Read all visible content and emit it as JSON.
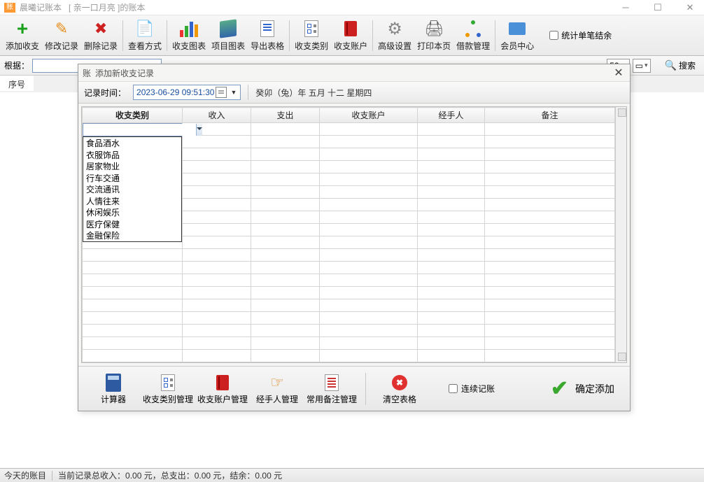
{
  "titlebar": {
    "app_name": "晨曦记账本",
    "book_name": "[ 亲一口月亮 ]的账本"
  },
  "toolbar": {
    "add": "添加收支",
    "edit": "修改记录",
    "delete": "删除记录",
    "view": "查看方式",
    "bar_chart": "收支图表",
    "item_chart": "项目图表",
    "export": "导出表格",
    "category": "收支类别",
    "account": "收支账户",
    "advanced": "高级设置",
    "print": "打印本页",
    "loan": "借款管理",
    "member": "会员中心",
    "stat_check": "统计单笔结余"
  },
  "search": {
    "label": "根据：",
    "counter": "59",
    "button": "搜索"
  },
  "bg": {
    "col0": "序号"
  },
  "modal": {
    "title": "添加新收支记录",
    "time_label": "记录时间：",
    "datetime": "2023-06-29 09:51:30",
    "lunar": "癸卯（兔）年 五月 十二 星期四",
    "headers": [
      "收支类别",
      "收入",
      "支出",
      "收支账户",
      "经手人",
      "备注"
    ],
    "dropdown_options": [
      "食品酒水",
      "衣服饰品",
      "居家物业",
      "行车交通",
      "交流通讯",
      "人情往来",
      "休闲娱乐",
      "医疗保健",
      "金融保险"
    ],
    "btns": {
      "calc": "计算器",
      "cat_mgr": "收支类别管理",
      "acc_mgr": "收支账户管理",
      "handler_mgr": "经手人管理",
      "note_mgr": "常用备注管理",
      "clear": "清空表格",
      "continuous": "连续记账",
      "confirm": "确定添加"
    }
  },
  "statusbar": {
    "left": "今天的账目",
    "summary": "当前记录总收入：0.00 元，总支出：0.00 元，结余：0.00 元"
  }
}
